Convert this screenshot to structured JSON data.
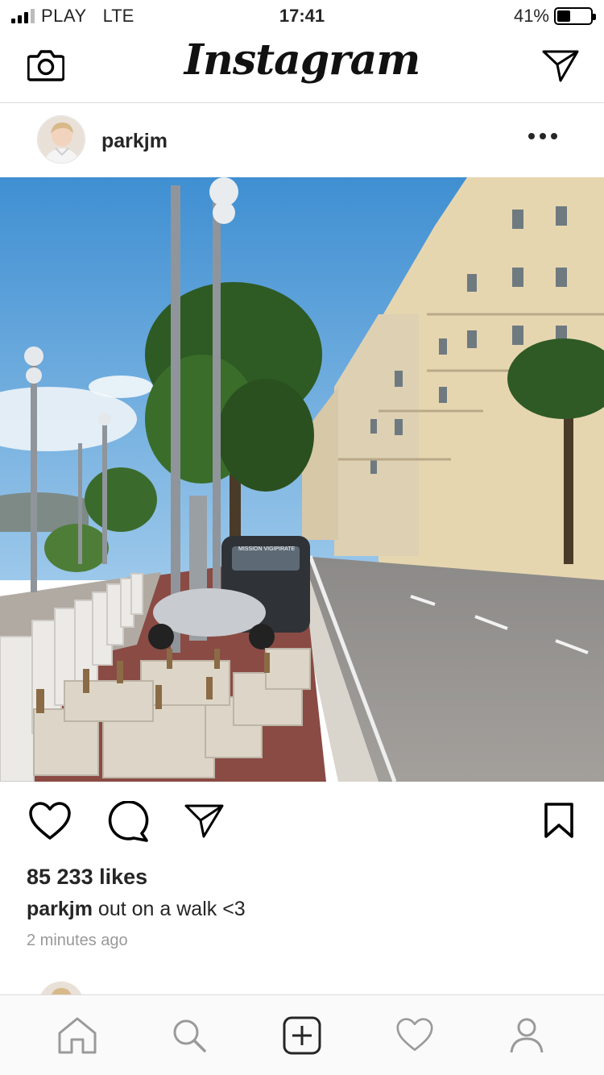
{
  "status_bar": {
    "carrier": "PLAY",
    "network": "LTE",
    "time": "17:41",
    "battery_text": "41%",
    "battery_level": 0.41
  },
  "header": {
    "title": "Instagram",
    "left_icon": "camera-icon",
    "right_icon": "direct-message-icon"
  },
  "post": {
    "username": "parkjm",
    "more_icon": "more-icon",
    "likes": "85 233 likes",
    "caption_user": "parkjm",
    "caption_text": " out on a walk <3",
    "time_ago": "2 minutes ago",
    "actions": [
      "heart-icon",
      "comment-icon",
      "share-icon",
      "bookmark-icon"
    ]
  },
  "tabbar": {
    "items": [
      "home-icon",
      "search-icon",
      "new-post-icon",
      "activity-heart-icon",
      "profile-icon"
    ]
  },
  "colors": {
    "text": "#262626",
    "muted": "#999999",
    "divider": "#dbdbdb",
    "tabbar_bg": "#fafafa",
    "sky": "#5a9fd6"
  }
}
